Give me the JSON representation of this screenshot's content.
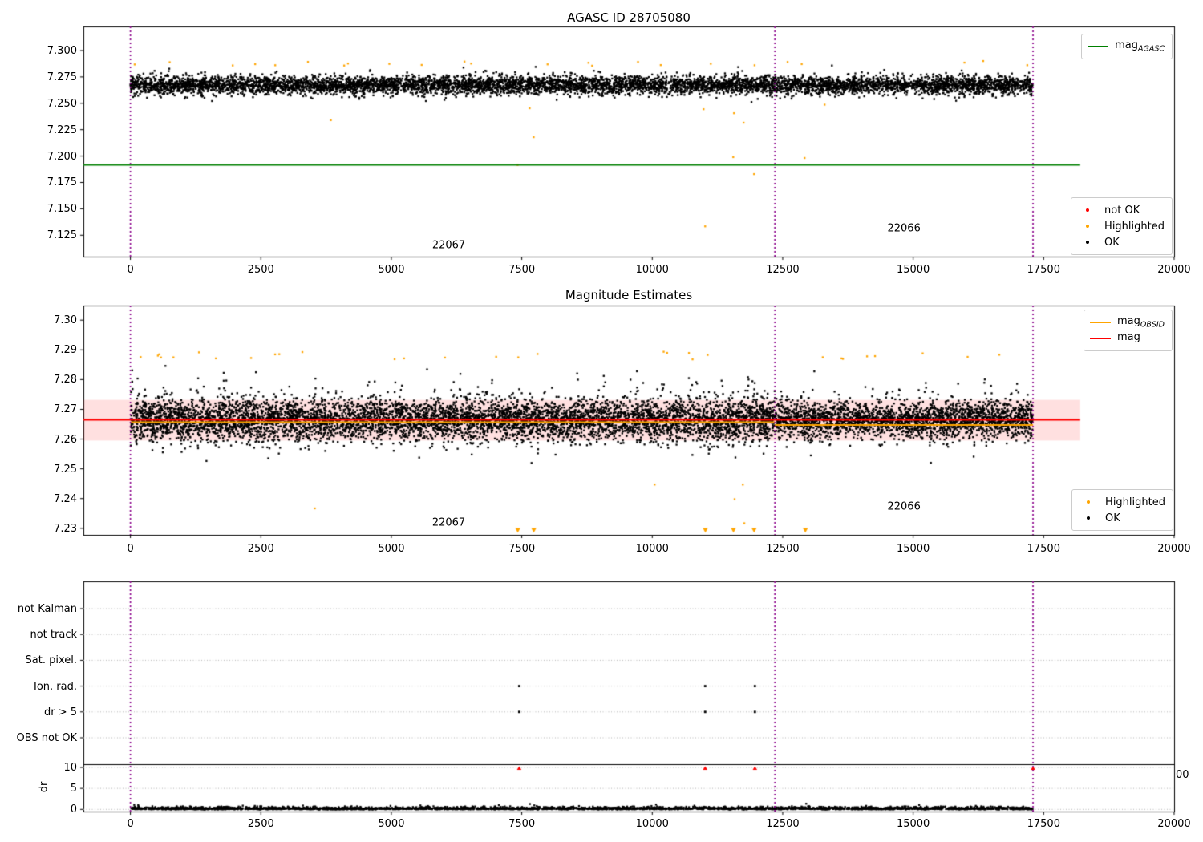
{
  "colors": {
    "green": "#008000",
    "red": "#ff0000",
    "orange": "#ffa500",
    "black": "#000000",
    "purple": "#8b008b",
    "band_pink": "rgba(255,0,0,0.12)",
    "grid": "#b4b4b4"
  },
  "chart_data": {
    "type": "scatter",
    "figure_title": "AGASC ID 28705080",
    "xlim": [
      -900,
      20000
    ],
    "xticks": {
      "labels": [
        "0",
        "2500",
        "5000",
        "7500",
        "10000",
        "12500",
        "15000",
        "17500",
        "20000"
      ],
      "values": [
        0,
        2500,
        5000,
        7500,
        10000,
        12500,
        15000,
        17500,
        20000
      ]
    },
    "vlines": {
      "style": "dotted",
      "color_key": "purple",
      "values": [
        0,
        12350,
        17296
      ]
    },
    "panels": [
      {
        "name": "agasc-mag",
        "title": "AGASC ID 28705080",
        "ylim": [
          7.1047,
          7.3228
        ],
        "yticks": {
          "labels": [
            "7.300",
            "7.275",
            "7.250",
            "7.225",
            "7.200",
            "7.175",
            "7.150",
            "7.125"
          ],
          "values": [
            7.3,
            7.275,
            7.25,
            7.225,
            7.2,
            7.175,
            7.15,
            7.125
          ]
        },
        "legend_line": {
          "main": "mag",
          "sub": "AGASC"
        },
        "legend_points": [
          {
            "label": "not OK",
            "color_key": "red"
          },
          {
            "label": "Highlighted",
            "color_key": "orange"
          },
          {
            "label": "OK",
            "color_key": "black"
          }
        ],
        "green_line": {
          "value": 7.1916,
          "x_span": [
            -900,
            18200
          ]
        },
        "annotations": [
          {
            "label": "22067",
            "x": 6100,
            "y": 7.115
          },
          {
            "label": "22066",
            "x": 14824,
            "y": 7.1315
          }
        ],
        "cloud": {
          "seed": 101,
          "n": 7000,
          "x_max": 17290,
          "center": 7.2672,
          "sigma": 0.0042,
          "y_min": 7.2512,
          "y_max": 7.2858,
          "orange_tops": 24
        },
        "orange_outliers": [
          [
            3840,
            7.234
          ],
          [
            7650,
            7.2453
          ],
          [
            7727,
            7.2179
          ],
          [
            7420,
            7.1916
          ],
          [
            10983,
            7.2444
          ],
          [
            11567,
            7.2406
          ],
          [
            11751,
            7.2316
          ],
          [
            11552,
            7.199
          ],
          [
            11951,
            7.1829
          ],
          [
            11014,
            7.1334
          ],
          [
            12919,
            7.1982
          ],
          [
            13303,
            7.2487
          ]
        ]
      },
      {
        "name": "magnitude-estimates",
        "title": "Magnitude Estimates",
        "ylim": [
          7.2278,
          7.3049
        ],
        "yticks": {
          "labels": [
            "7.30",
            "7.29",
            "7.28",
            "7.27",
            "7.26",
            "7.25",
            "7.24",
            "7.23"
          ],
          "values": [
            7.3,
            7.29,
            7.28,
            7.27,
            7.26,
            7.25,
            7.24,
            7.23
          ]
        },
        "legend_lines": [
          {
            "main": "mag",
            "sub": "OBSID",
            "color_key": "orange"
          },
          {
            "main": "mag",
            "sub": "",
            "color_key": "red"
          }
        ],
        "legend_points": [
          {
            "label": "Highlighted",
            "color_key": "orange"
          },
          {
            "label": "OK",
            "color_key": "black"
          }
        ],
        "red_line": {
          "value": 7.2665,
          "x_span": [
            -900,
            18200
          ]
        },
        "band": {
          "y0": 7.2595,
          "y1": 7.2732,
          "x_span": [
            -900,
            18200
          ]
        },
        "orange_segments": [
          {
            "x0": 0,
            "x1": 12350,
            "value": 7.2657
          },
          {
            "x0": 12350,
            "x1": 17296,
            "value": 7.2647
          }
        ],
        "annotations": [
          {
            "label": "22067",
            "x": 6100,
            "y": 7.2318
          },
          {
            "label": "22066",
            "x": 14824,
            "y": 7.2372
          }
        ],
        "cloud": {
          "seed": 202,
          "n": 9000,
          "x_max": 17290,
          "center": 7.2663,
          "sigma": 0.0034,
          "y_min": 7.2468,
          "y_max": 7.2892,
          "orange_tops": 30
        },
        "orange_outliers": [
          [
            3533,
            7.2367
          ],
          [
            10046,
            7.2447
          ],
          [
            11736,
            7.2447
          ],
          [
            11578,
            7.2398
          ],
          [
            11764,
            7.2317
          ]
        ],
        "clip_markers_bottom": [
          7423,
          7730,
          11018,
          11556,
          11951,
          12934
        ]
      },
      {
        "name": "flags",
        "categories": [
          "not Kalman",
          "not track",
          "Sat. pixel.",
          "Ion. rad.",
          "dr > 5",
          "OBS not OK"
        ],
        "flag_points": [
          {
            "x": 7450,
            "category": 3
          },
          {
            "x": 11014,
            "category": 3
          },
          {
            "x": 11967,
            "category": 3
          },
          {
            "x": 7450,
            "category": 4
          },
          {
            "x": 11014,
            "category": 4
          },
          {
            "x": 11967,
            "category": 4
          }
        ],
        "dr_ylabel": "dr",
        "dr_ticks": {
          "labels": [
            "10",
            "5",
            "0"
          ],
          "values": [
            10,
            5,
            0
          ]
        },
        "dr_red_points": [
          7450,
          11014,
          11967,
          17296
        ],
        "dr_extra_points": [
          [
            12950,
            1.35
          ],
          [
            7060,
            1.0
          ],
          [
            16200,
            0.85
          ]
        ],
        "dr_cloud": {
          "seed": 303,
          "n": 3000,
          "x_max": 17290
        },
        "clipped_xtick": "00"
      }
    ]
  }
}
